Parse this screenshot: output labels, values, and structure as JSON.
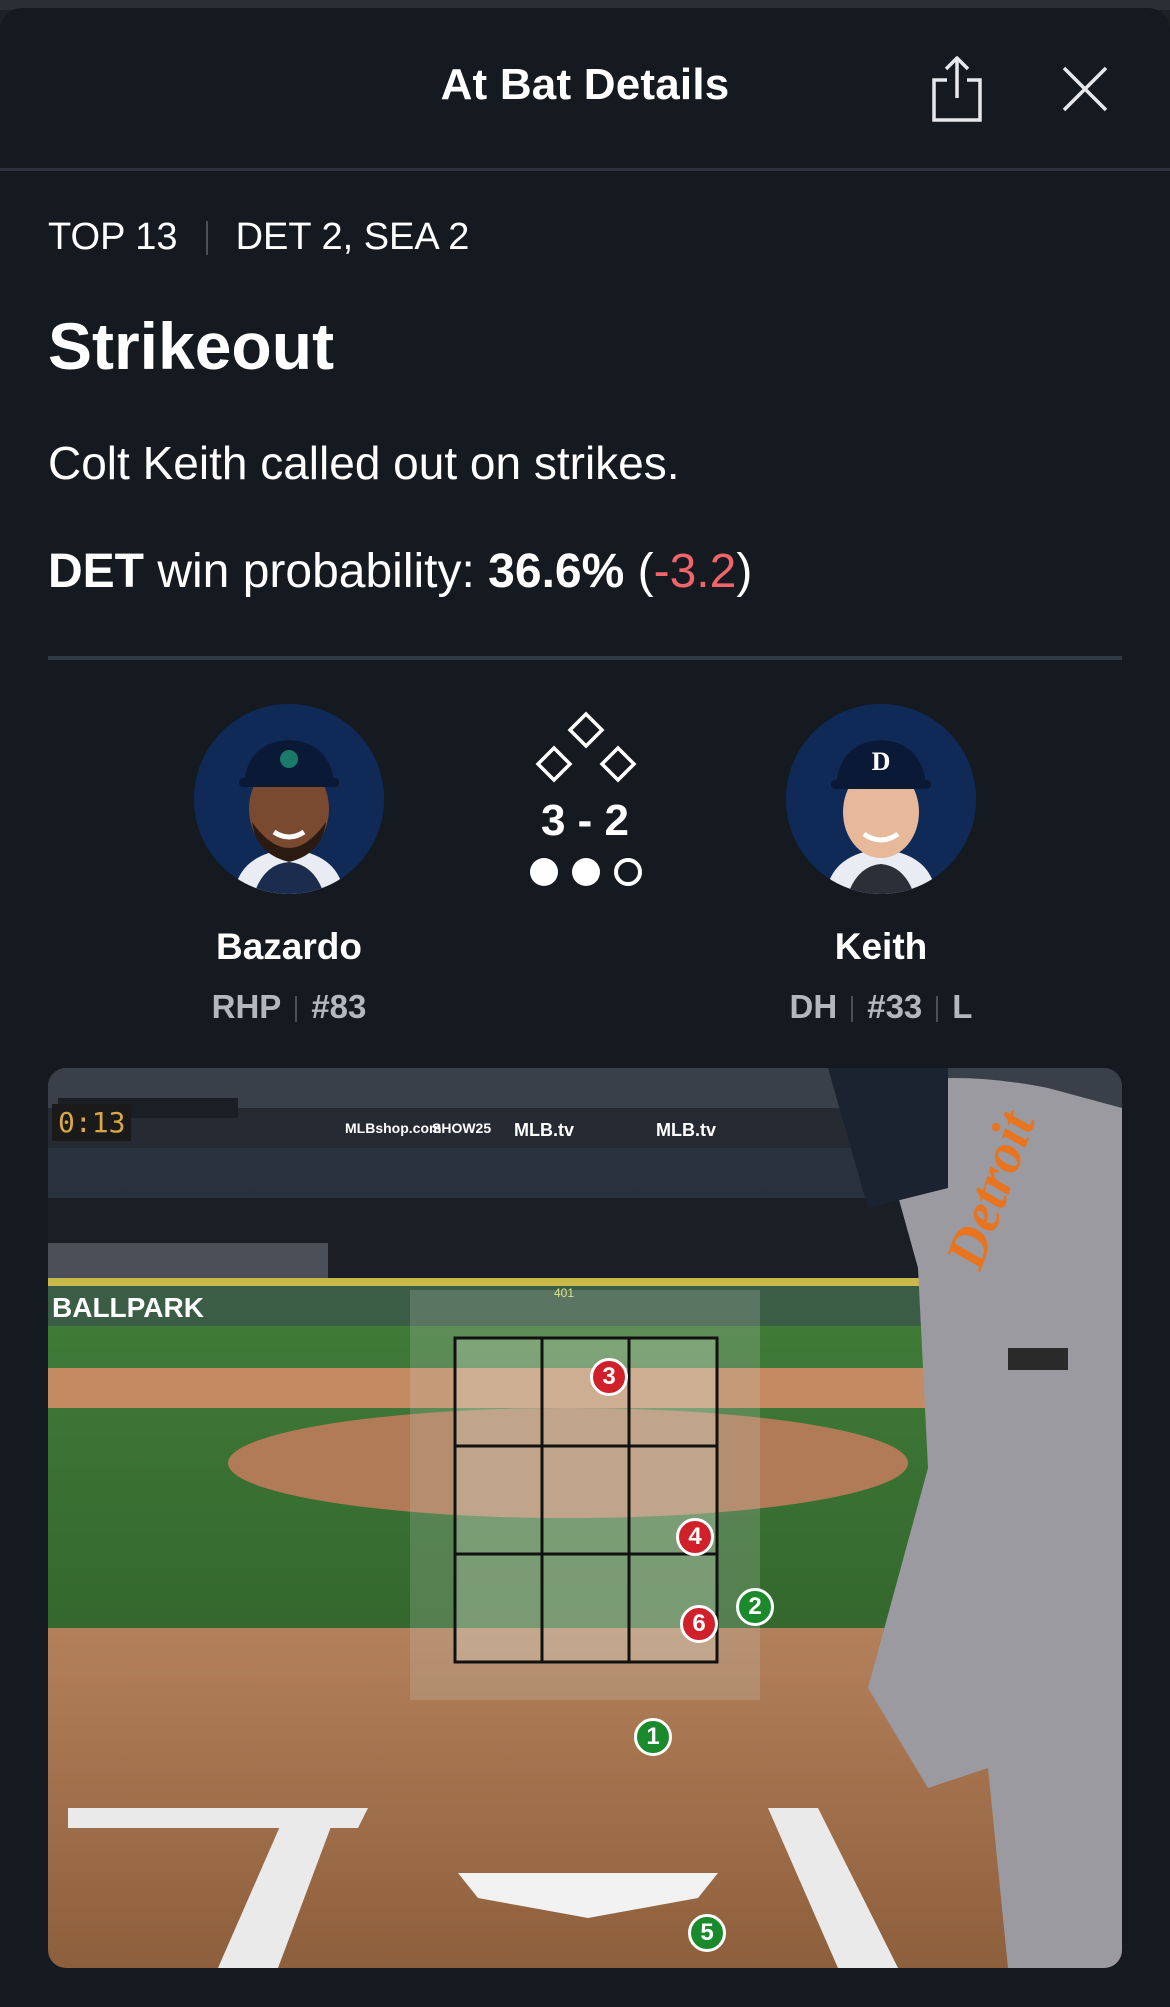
{
  "header": {
    "title": "At Bat Details",
    "share_icon": "share-icon",
    "close_icon": "close-icon"
  },
  "situation": {
    "inning": "TOP 13",
    "score": "DET 2, SEA 2"
  },
  "result": {
    "title": "Strikeout",
    "description": "Colt Keith called out on strikes.",
    "win_prob_team": "DET",
    "win_prob_label": "win probability:",
    "win_prob_value": "36.6%",
    "win_prob_change": "-3.2"
  },
  "pitcher": {
    "name": "Bazardo",
    "position": "RHP",
    "number": "#83"
  },
  "batter": {
    "name": "Keith",
    "position": "DH",
    "number": "#33",
    "bats": "L"
  },
  "count": {
    "text": "3 - 2",
    "outs_filled": 2,
    "outs_total": 3,
    "bases_occupied": []
  },
  "video": {
    "clock": "0:13",
    "ads": [
      "MLBshop.com",
      "SHOW25",
      "MLB.tv",
      "MLB.tv"
    ],
    "wall_text": "BALLPARK",
    "distance": "401",
    "jersey_text": "Detroit"
  },
  "pitches": [
    {
      "num": "1",
      "type": "ball"
    },
    {
      "num": "2",
      "type": "ball"
    },
    {
      "num": "3",
      "type": "strike"
    },
    {
      "num": "4",
      "type": "strike"
    },
    {
      "num": "5",
      "type": "ball"
    },
    {
      "num": "6",
      "type": "strike"
    }
  ],
  "colors": {
    "background": "#151a20",
    "ball": "#1a8a2c",
    "strike": "#d0202a",
    "negative": "#f0646a",
    "avatar_bg": "#0f2a57"
  }
}
